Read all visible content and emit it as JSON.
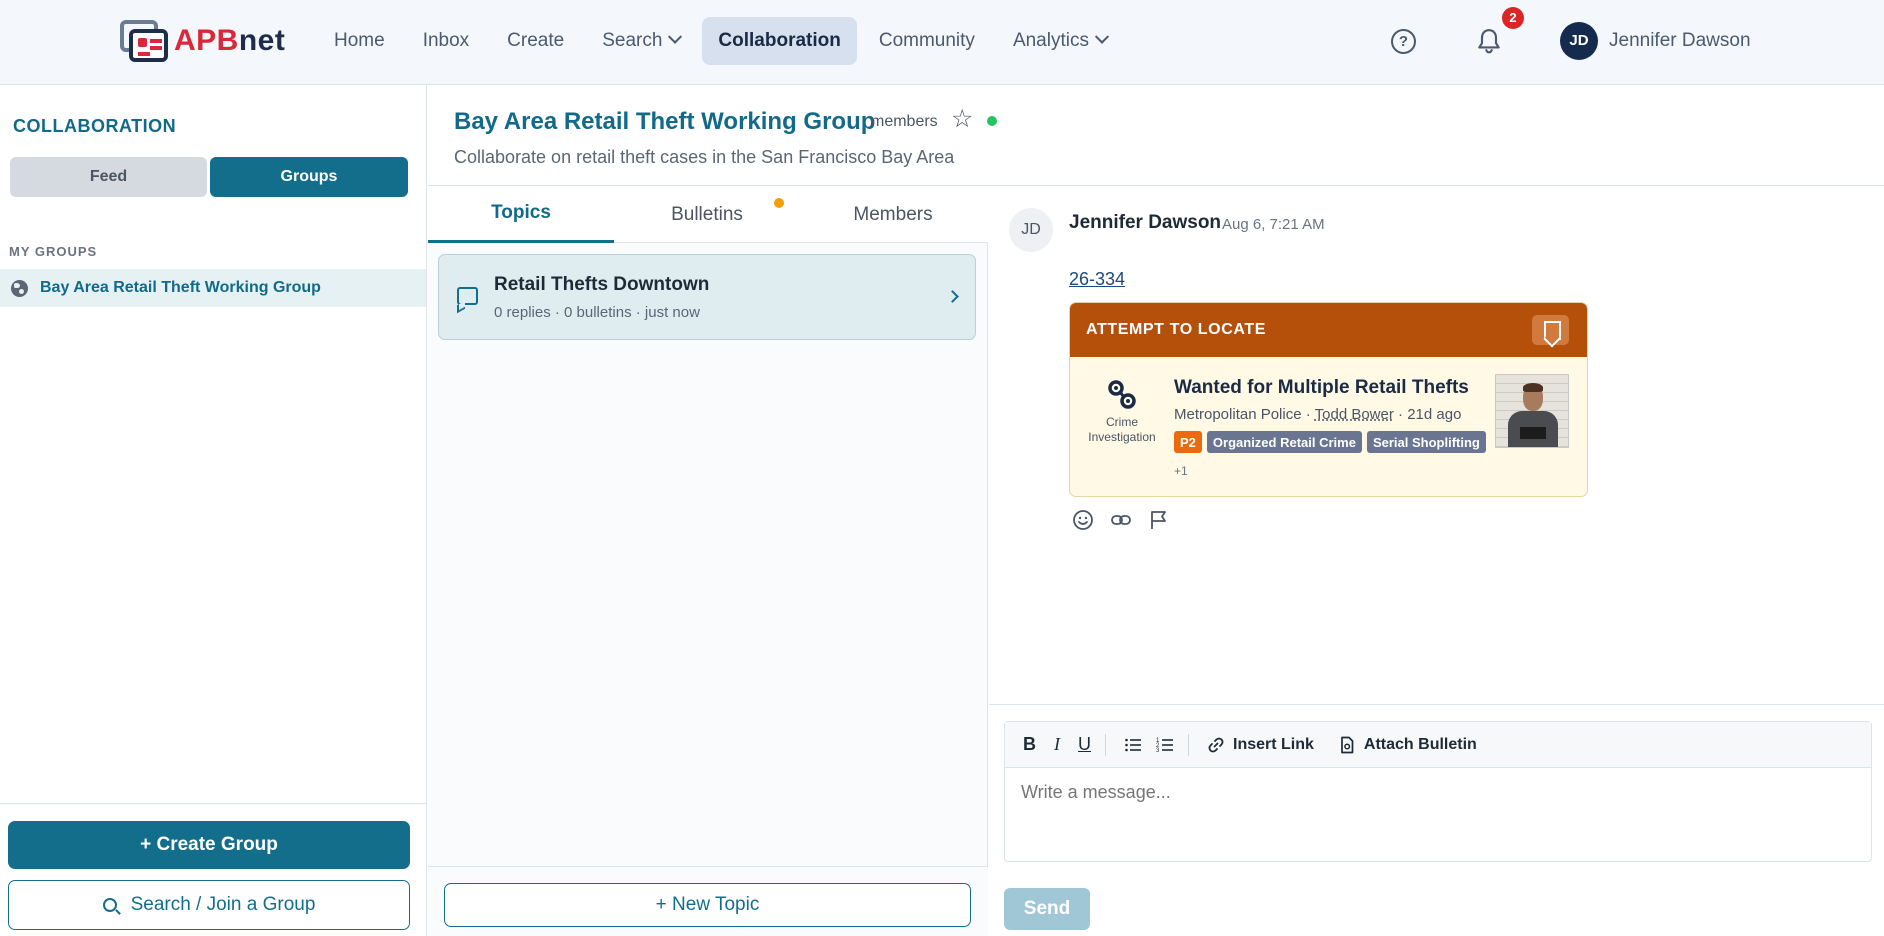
{
  "app": {
    "logo_apb": "APB",
    "logo_net": "net",
    "nav": [
      {
        "label": "Home"
      },
      {
        "label": "Inbox"
      },
      {
        "label": "Create"
      },
      {
        "label": "Search"
      },
      {
        "label": "Collaboration"
      },
      {
        "label": "Community"
      },
      {
        "label": "Analytics"
      }
    ],
    "active_nav": "Collaboration",
    "help_icon": "?",
    "notification_count": "2",
    "user_initials": "JD",
    "user_name": "Jennifer Dawson"
  },
  "sidebar": {
    "title": "COLLABORATION",
    "segment_feed": "Feed",
    "segment_groups": "Groups",
    "active_segment": "Groups",
    "section_label": "MY GROUPS",
    "groups": [
      {
        "name": "Bay Area Retail Theft Working Group",
        "icon": "globe-icon"
      }
    ],
    "create_button": "+ Create Group",
    "search_button": "Search / Join a Group"
  },
  "group": {
    "title": "Bay Area Retail Theft Working Group",
    "members_label": "members",
    "description": "Collaborate on retail theft cases in the San Francisco Bay Area",
    "online_color": "#22c55e"
  },
  "topics": {
    "tabs": [
      {
        "label": "Topics"
      },
      {
        "label": "Bulletins"
      },
      {
        "label": "Members"
      }
    ],
    "active_tab": "Topics",
    "items": [
      {
        "title": "Retail Thefts Downtown",
        "meta": "0 replies · 0 bulletins · just now"
      }
    ],
    "new_topic_button": "+ New Topic"
  },
  "message": {
    "avatar": "JD",
    "author": "Jennifer Dawson",
    "time": "Aug 6, 7:21 AM",
    "link_text": "26-334",
    "bulletin": {
      "type": "ATTEMPT TO LOCATE",
      "category_line1": "Crime",
      "category_line2": "Investigation",
      "title": "Wanted for Multiple Retail Thefts",
      "agency": "Metropolitan Police",
      "separator": " · ",
      "officer": "Todd Bower",
      "age": "21d ago",
      "priority": "P2",
      "tags": [
        "Organized Retail Crime",
        "Serial Shoplifting"
      ],
      "more": "+1",
      "header_color": "#b5500b"
    }
  },
  "composer": {
    "bold": "B",
    "italic": "I",
    "underline": "U",
    "insert_link": "Insert Link",
    "attach_bulletin": "Attach Bulletin",
    "placeholder": "Write a message...",
    "send": "Send"
  },
  "colors": {
    "primary": "#136e8c",
    "alert": "#dc2626"
  }
}
